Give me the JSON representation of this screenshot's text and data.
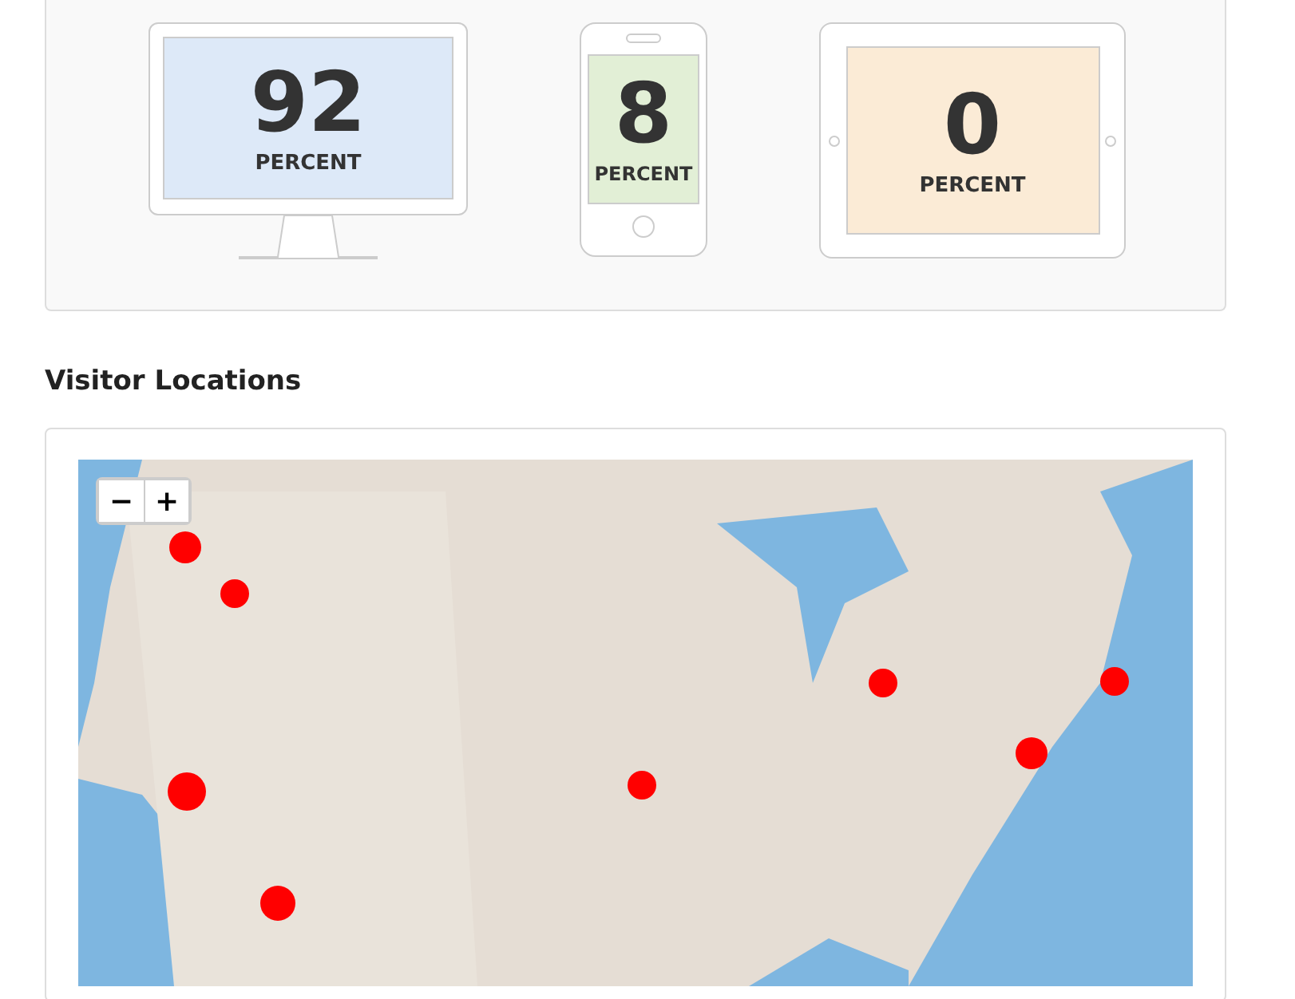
{
  "devices": [
    {
      "kind": "desktop",
      "value": "92",
      "label": "PERCENT"
    },
    {
      "kind": "phone",
      "value": "8",
      "label": "PERCENT"
    },
    {
      "kind": "tablet",
      "value": "0",
      "label": "PERCENT"
    }
  ],
  "section_title": "Visitor Locations",
  "map": {
    "zoom_out": "−",
    "zoom_in": "+"
  }
}
